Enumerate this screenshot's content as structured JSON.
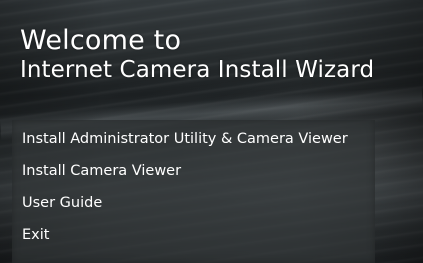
{
  "window": {
    "title_line1": "Welcome to",
    "title_line2": "Internet Camera Install Wizard"
  },
  "menu": {
    "items": [
      {
        "label": "Install Administrator Utility & Camera Viewer"
      },
      {
        "label": "Install Camera Viewer"
      },
      {
        "label": "User Guide"
      },
      {
        "label": "Exit"
      }
    ]
  },
  "colors": {
    "text": "#ffffff",
    "panel": "#323638",
    "background": "#2a2f31"
  }
}
